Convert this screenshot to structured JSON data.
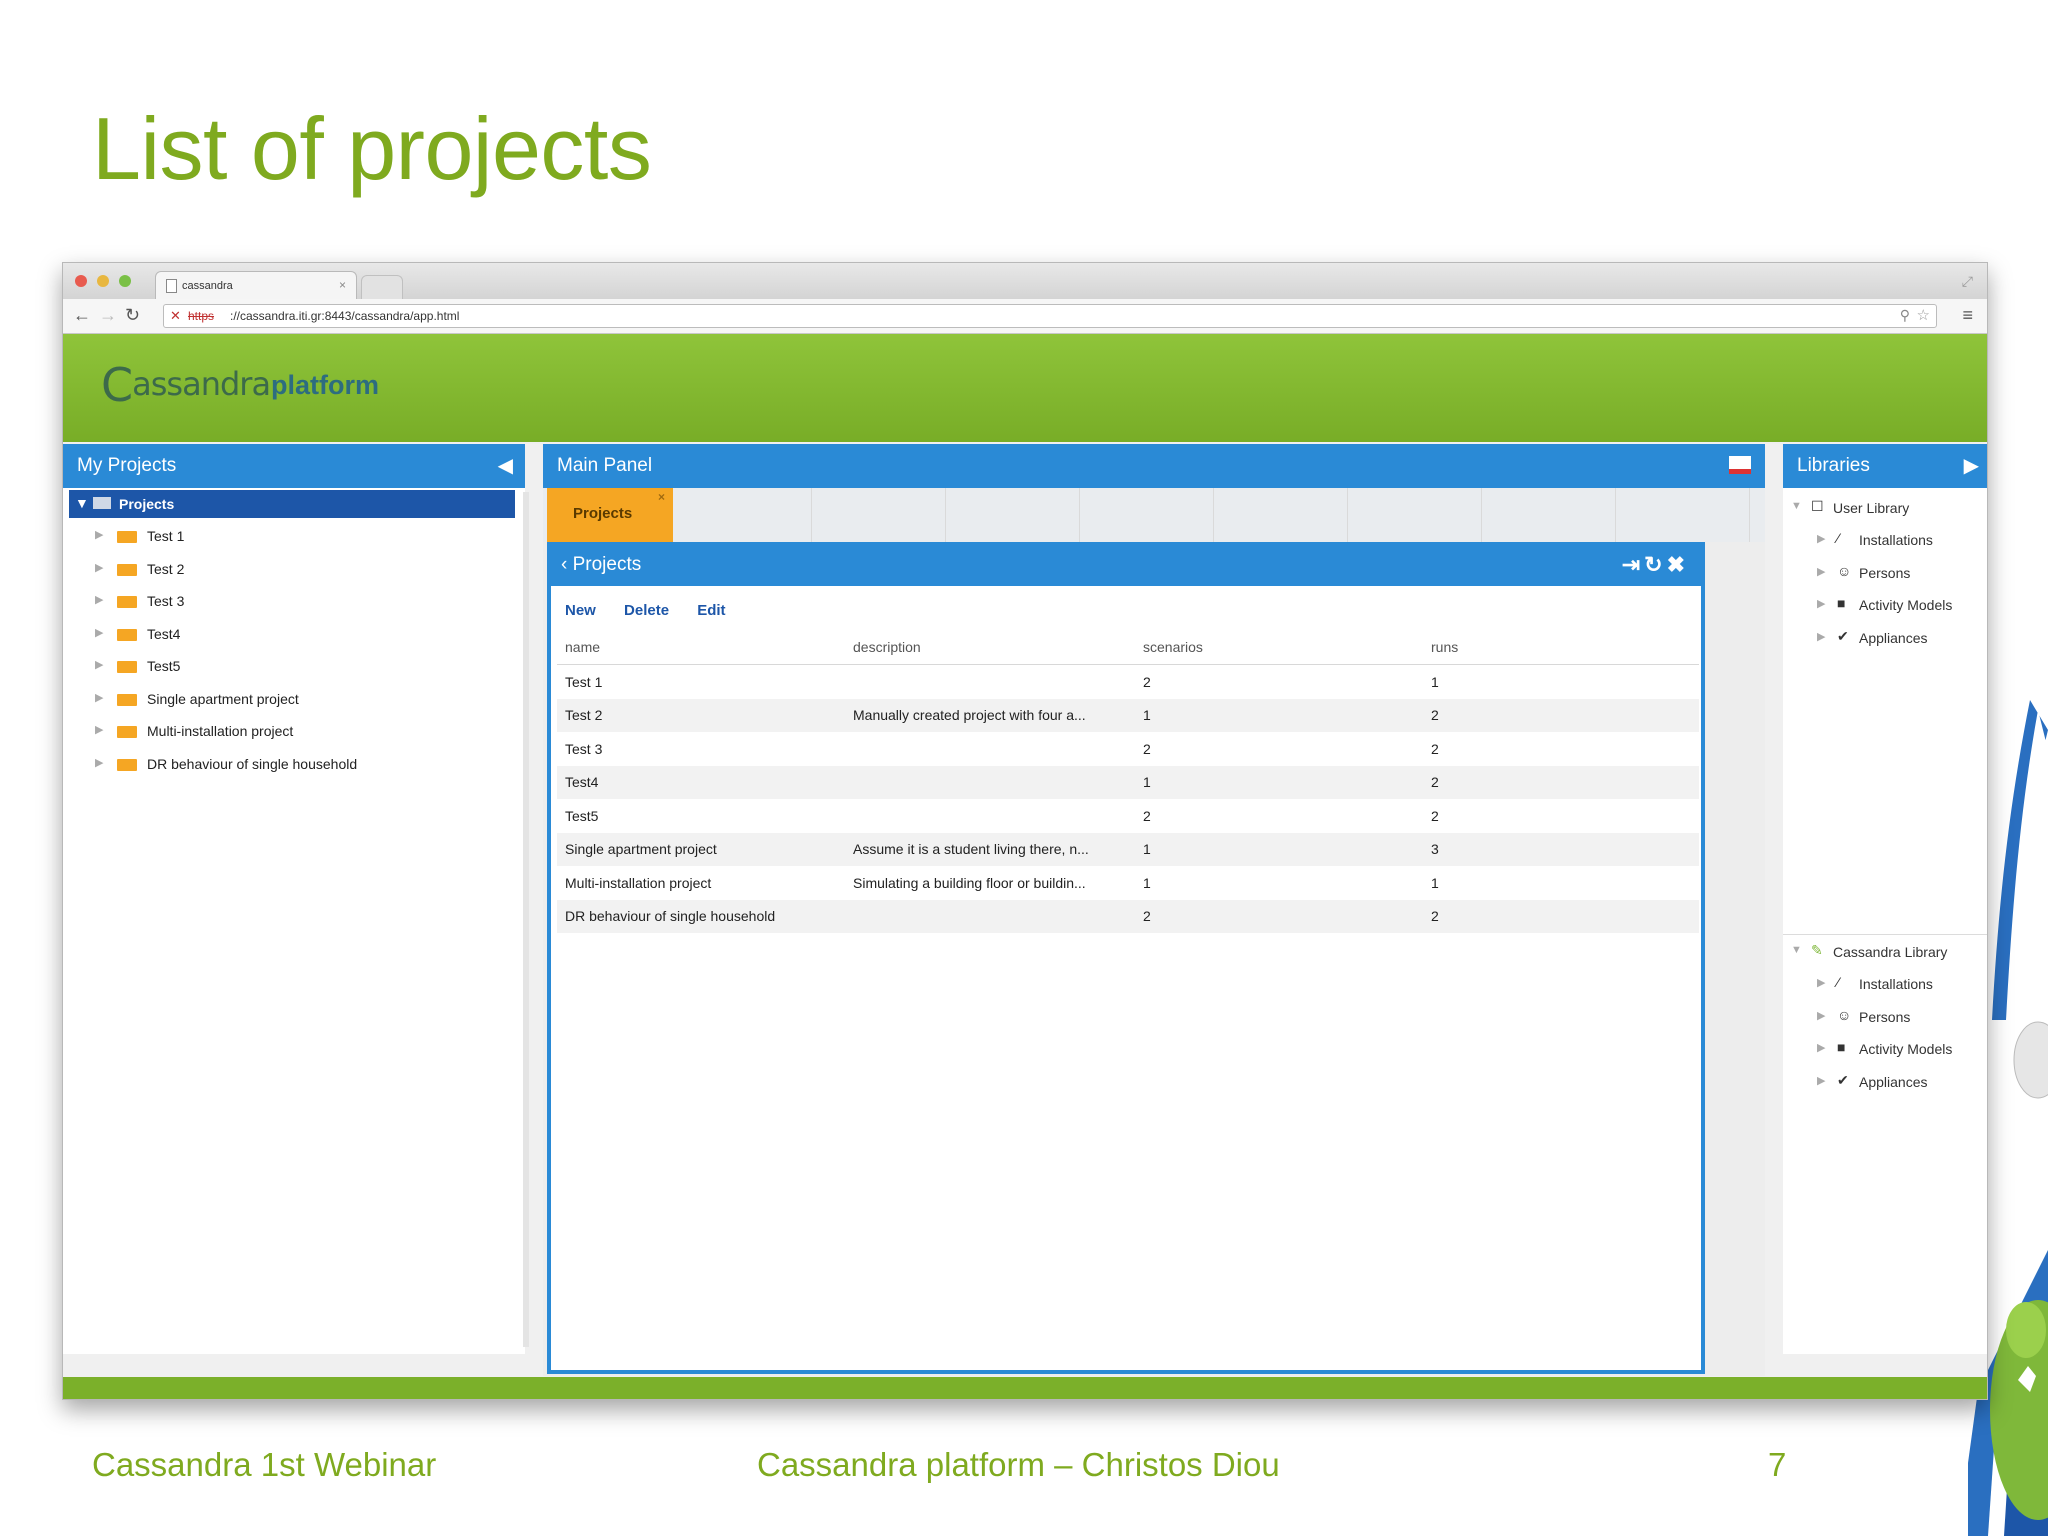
{
  "slide": {
    "title": "List of projects",
    "footer_left": "Cassandra 1st Webinar",
    "footer_center": "Cassandra platform – Christos Diou",
    "page_number": "7"
  },
  "browser": {
    "tab_title": "cassandra",
    "url_scheme": "https",
    "url_rest": "://cassandra.iti.gr:8443/cassandra/app.html"
  },
  "app": {
    "logo_text": "assandra",
    "logo_initial": "C",
    "logo_sub": "platform"
  },
  "left_panel": {
    "title": "My Projects",
    "root": "Projects",
    "items": [
      {
        "label": "Test 1"
      },
      {
        "label": "Test 2"
      },
      {
        "label": "Test 3"
      },
      {
        "label": "Test4"
      },
      {
        "label": "Test5"
      },
      {
        "label": "Single apartment project"
      },
      {
        "label": "Multi-installation project"
      },
      {
        "label": "DR behaviour of single household"
      }
    ]
  },
  "main_panel": {
    "title": "Main Panel",
    "tab_label": "Projects",
    "window_title": "‹ Projects",
    "actions": {
      "new": "New",
      "delete": "Delete",
      "edit": "Edit"
    },
    "columns": {
      "name": "name",
      "description": "description",
      "scenarios": "scenarios",
      "runs": "runs"
    },
    "rows": [
      {
        "name": "Test 1",
        "description": "",
        "scenarios": "2",
        "runs": "1"
      },
      {
        "name": "Test 2",
        "description": "Manually created project with four a...",
        "scenarios": "1",
        "runs": "2"
      },
      {
        "name": "Test 3",
        "description": "",
        "scenarios": "2",
        "runs": "2"
      },
      {
        "name": "Test4",
        "description": "",
        "scenarios": "1",
        "runs": "2"
      },
      {
        "name": "Test5",
        "description": "",
        "scenarios": "2",
        "runs": "2"
      },
      {
        "name": "Single apartment project",
        "description": "Assume it is a student living there, n...",
        "scenarios": "1",
        "runs": "3"
      },
      {
        "name": "Multi-installation project",
        "description": "Simulating a building floor or buildin...",
        "scenarios": "1",
        "runs": "1"
      },
      {
        "name": "DR behaviour of single household",
        "description": "",
        "scenarios": "2",
        "runs": "2"
      }
    ]
  },
  "right_panel": {
    "title": "Libraries",
    "user_library": {
      "label": "User Library",
      "items": [
        "Installations",
        "Persons",
        "Activity Models",
        "Appliances"
      ]
    },
    "cassandra_library": {
      "label": "Cassandra Library",
      "items": [
        "Installations",
        "Persons",
        "Activity Models",
        "Appliances"
      ]
    }
  },
  "colors": {
    "title_green": "#7faa1f",
    "header_green": "#7bb02a",
    "panel_blue": "#2a8ad6",
    "selection_blue": "#1d56a8",
    "tab_orange": "#f5a623"
  }
}
